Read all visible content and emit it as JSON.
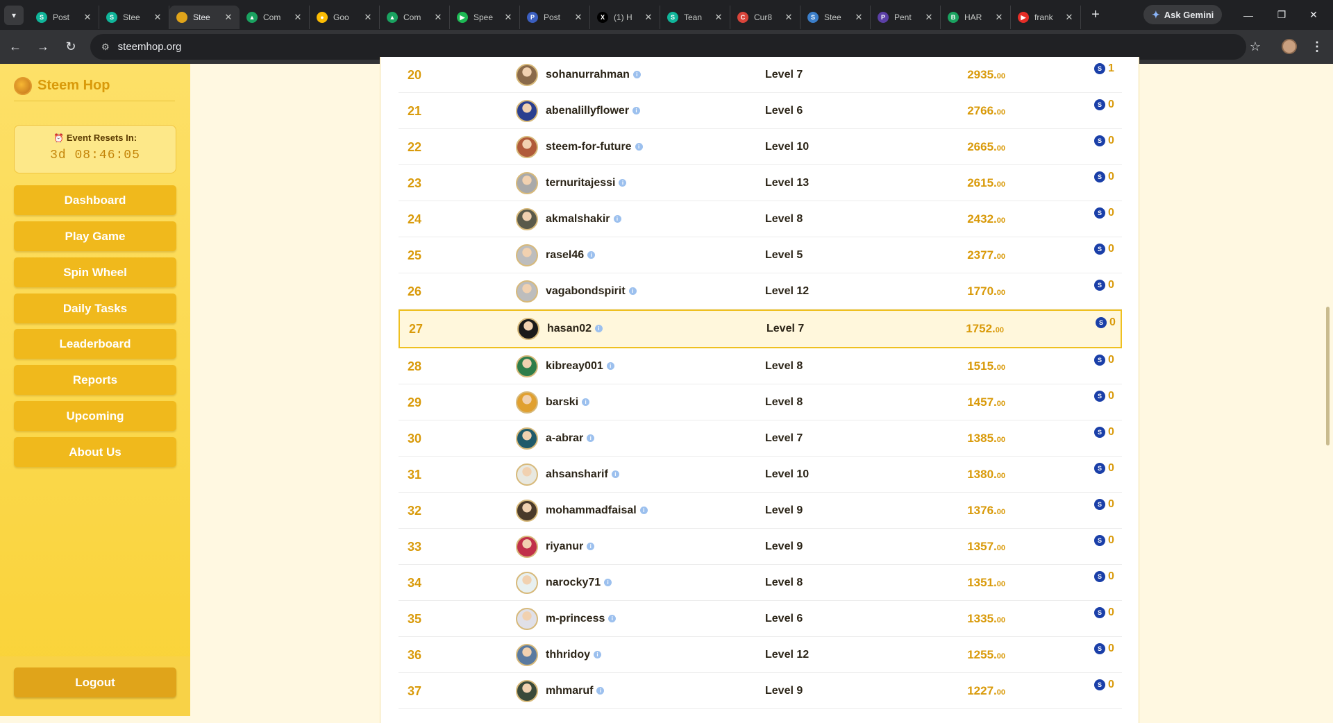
{
  "browser": {
    "tabs": [
      {
        "title": "Post",
        "color": "#10b59a",
        "glyph": "S"
      },
      {
        "title": "Stee",
        "color": "#10b59a",
        "glyph": "S"
      },
      {
        "title": "Stee",
        "color": "#e0a41a",
        "glyph": "",
        "active": true
      },
      {
        "title": "Com",
        "color": "#1aa260",
        "glyph": "▲"
      },
      {
        "title": "Goo",
        "color": "#fbbc04",
        "glyph": "●"
      },
      {
        "title": "Com",
        "color": "#1aa260",
        "glyph": "▲"
      },
      {
        "title": "Spee",
        "color": "#1db954",
        "glyph": "▶"
      },
      {
        "title": "Post",
        "color": "#3b5fc0",
        "glyph": "P"
      },
      {
        "title": "(1) H",
        "color": "#000000",
        "glyph": "X"
      },
      {
        "title": "Tean",
        "color": "#10b59a",
        "glyph": "S"
      },
      {
        "title": "Cur8",
        "color": "#d9443a",
        "glyph": "C"
      },
      {
        "title": "Stee",
        "color": "#3b7ec9",
        "glyph": "S"
      },
      {
        "title": "Pent",
        "color": "#5b3fa6",
        "glyph": "P"
      },
      {
        "title": "HAR",
        "color": "#1aa260",
        "glyph": "B"
      },
      {
        "title": "frank",
        "color": "#e52d27",
        "glyph": "▶"
      }
    ],
    "new_tab": "+",
    "gemini": "Ask Gemini",
    "url": "steemhop.org"
  },
  "sidebar": {
    "brand": "Steem Hop",
    "timer_label": "Event Resets In:",
    "timer_value": "3d 08:46:05",
    "nav": [
      "Dashboard",
      "Play Game",
      "Spin Wheel",
      "Daily Tasks",
      "Leaderboard",
      "Reports",
      "Upcoming",
      "About Us"
    ],
    "logout": "Logout"
  },
  "leaderboard": {
    "rows": [
      {
        "rank": "20",
        "user": "sohanurrahman",
        "level": "Level 7",
        "score": "2935.",
        "dec": "00",
        "reward": "1",
        "avatar": "#8a6a4a"
      },
      {
        "rank": "21",
        "user": "abenalillyflower",
        "level": "Level 6",
        "score": "2766.",
        "dec": "00",
        "reward": "0",
        "avatar": "#2a3f8f"
      },
      {
        "rank": "22",
        "user": "steem-for-future",
        "level": "Level 10",
        "score": "2665.",
        "dec": "00",
        "reward": "0",
        "avatar": "#b05a3a"
      },
      {
        "rank": "23",
        "user": "ternuritajessi",
        "level": "Level 13",
        "score": "2615.",
        "dec": "00",
        "reward": "0",
        "avatar": "#a9a9a9"
      },
      {
        "rank": "24",
        "user": "akmalshakir",
        "level": "Level 8",
        "score": "2432.",
        "dec": "00",
        "reward": "0",
        "avatar": "#5a5a4a"
      },
      {
        "rank": "25",
        "user": "rasel46",
        "level": "Level 5",
        "score": "2377.",
        "dec": "00",
        "reward": "0",
        "avatar": "#bdbdbd"
      },
      {
        "rank": "26",
        "user": "vagabondspirit",
        "level": "Level 12",
        "score": "1770.",
        "dec": "00",
        "reward": "0",
        "avatar": "#bdbdbd"
      },
      {
        "rank": "27",
        "user": "hasan02",
        "level": "Level 7",
        "score": "1752.",
        "dec": "00",
        "reward": "0",
        "avatar": "#1a1a1a",
        "highlight": true
      },
      {
        "rank": "28",
        "user": "kibreay001",
        "level": "Level 8",
        "score": "1515.",
        "dec": "00",
        "reward": "0",
        "avatar": "#2e7d4a"
      },
      {
        "rank": "29",
        "user": "barski",
        "level": "Level 8",
        "score": "1457.",
        "dec": "00",
        "reward": "0",
        "avatar": "#e0a030"
      },
      {
        "rank": "30",
        "user": "a-abrar",
        "level": "Level 7",
        "score": "1385.",
        "dec": "00",
        "reward": "0",
        "avatar": "#1f5a6a"
      },
      {
        "rank": "31",
        "user": "ahsansharif",
        "level": "Level 10",
        "score": "1380.",
        "dec": "00",
        "reward": "0",
        "avatar": "#e8e8e0"
      },
      {
        "rank": "32",
        "user": "mohammadfaisal",
        "level": "Level 9",
        "score": "1376.",
        "dec": "00",
        "reward": "0",
        "avatar": "#4a3a2a"
      },
      {
        "rank": "33",
        "user": "riyanur",
        "level": "Level 9",
        "score": "1357.",
        "dec": "00",
        "reward": "0",
        "avatar": "#c0304a"
      },
      {
        "rank": "34",
        "user": "narocky71",
        "level": "Level 8",
        "score": "1351.",
        "dec": "00",
        "reward": "0",
        "avatar": "#e8f0f0"
      },
      {
        "rank": "35",
        "user": "m-princess",
        "level": "Level 6",
        "score": "1335.",
        "dec": "00",
        "reward": "0",
        "avatar": "#e0e0e8"
      },
      {
        "rank": "36",
        "user": "thhridoy",
        "level": "Level 12",
        "score": "1255.",
        "dec": "00",
        "reward": "0",
        "avatar": "#5a7aa0"
      },
      {
        "rank": "37",
        "user": "mhmaruf",
        "level": "Level 9",
        "score": "1227.",
        "dec": "00",
        "reward": "0",
        "avatar": "#3a4a3a"
      }
    ]
  }
}
